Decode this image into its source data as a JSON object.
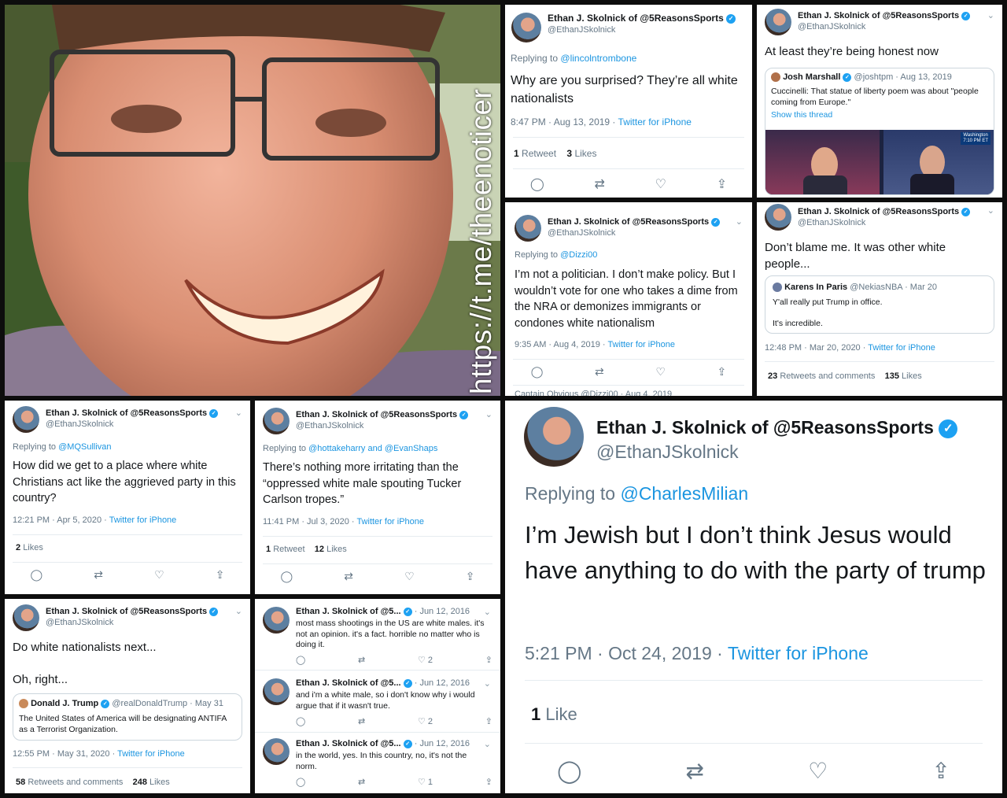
{
  "author": {
    "name": "Ethan J. Skolnick of @5ReasonsSports",
    "short_name": "Ethan J. Skolnick of @5...",
    "handle": "@EthanJSkolnick"
  },
  "watermark": "https://t.me/theenoticer",
  "icons": {
    "reply": "reply-icon",
    "retweet": "retweet-icon",
    "like": "heart-icon",
    "share": "share-icon",
    "verified": "verified-badge-icon",
    "more": "chevron-down-icon"
  },
  "t1": {
    "replying_prefix": "Replying to",
    "replying_to": "@lincolntrombone",
    "text": "Why are you surprised? They’re all white nationalists",
    "time": "8:47 PM · Aug 13, 2019 · ",
    "source": "Twitter for iPhone",
    "retweets": "1",
    "retweets_label": "Retweet",
    "likes": "3",
    "likes_label": "Likes"
  },
  "t2": {
    "text": "At least they’re being honest now",
    "quote_name": "Josh Marshall",
    "quote_meta": "@joshtpm · Aug 13, 2019",
    "quote_text": "Cuccinelli: That statue of liberty poem was about \"people coming from Europe.\"",
    "quote_link": "Show this thread",
    "tv_label": "Washington\n7:10 PM ET"
  },
  "t3": {
    "replying_prefix": "Replying to",
    "replying_to": "@Dizzi00",
    "text": "I’m not a politician. I don’t make policy. But I wouldn’t vote for one who takes a dime from the NRA or demonizes immigrants or condones white nationalism",
    "time": "9:35 AM · Aug 4, 2019 · ",
    "source": "Twitter for iPhone",
    "cutoff": "Captain Obvious @Dizzi00 · Aug 4, 2019"
  },
  "t4": {
    "text": "Don’t blame me. It was other white people...",
    "quote_name": "Karens In Paris",
    "quote_meta": "@NekiasNBA · Mar 20",
    "quote_text1": "Y'all really put Trump in office.",
    "quote_text2": "It's incredible.",
    "time": "12:48 PM · Mar 20, 2020 · ",
    "source": "Twitter for iPhone",
    "retweets": "23",
    "retweets_label": "Retweets and comments",
    "likes": "135",
    "likes_label": "Likes"
  },
  "t5": {
    "replying_prefix": "Replying to",
    "replying_to": "@MQSullivan",
    "text": "How did we get to a place where white Christians act like the aggrieved party in this country?",
    "time": "12:21 PM · Apr 5, 2020 · ",
    "source": "Twitter for iPhone",
    "likes": "2",
    "likes_label": "Likes"
  },
  "t6": {
    "replying_prefix": "Replying to",
    "replying_to": "@hottakeharry and @EvanShaps",
    "text": "There’s nothing more irritating than the “oppressed white male spouting Tucker Carlson tropes.”",
    "time": "11:41 PM · Jul 3, 2020 · ",
    "source": "Twitter for iPhone",
    "retweets": "1",
    "retweets_label": "Retweet",
    "likes": "12",
    "likes_label": "Likes"
  },
  "t7": {
    "replying_prefix": "Replying to",
    "replying_to": "@CharlesMilian",
    "text": "I’m Jewish but I don’t think Jesus would have anything to do with the party of trump",
    "time": "5:21 PM · Oct 24, 2019 · ",
    "source": "Twitter for iPhone",
    "likes": "1",
    "likes_label": "Like"
  },
  "t8": {
    "text1": "Do white nationalists next...",
    "text2": "Oh, right...",
    "quote_name": "Donald J. Trump",
    "quote_meta": "@realDonaldTrump · May 31",
    "quote_text": "The United States of America will be designating ANTIFA as a Terrorist Organization.",
    "time": "12:55 PM · May 31, 2020 · ",
    "source": "Twitter for iPhone",
    "retweets": "58",
    "retweets_label": "Retweets and comments",
    "likes": "248",
    "likes_label": "Likes"
  },
  "t9": [
    {
      "date": "· Jun 12, 2016",
      "text": "most mass shootings in the US are white males. it's not an opinion. it's a fact. horrible no matter who is doing it.",
      "likes": "2"
    },
    {
      "date": "· Jun 12, 2016",
      "text": "and i'm a white male, so i don't know why i would argue that if it wasn't true.",
      "likes": "2"
    },
    {
      "date": "· Jun 12, 2016",
      "text": "in the world, yes. In this country, no, it's not the norm.",
      "likes": "1"
    }
  ]
}
